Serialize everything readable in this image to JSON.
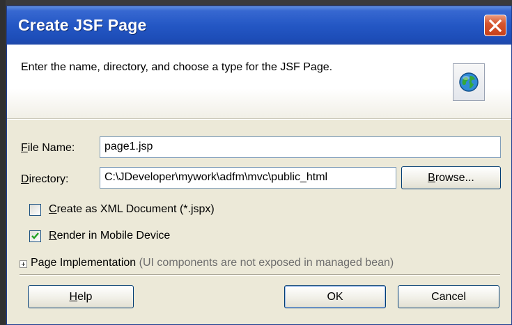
{
  "dialog": {
    "title": "Create JSF Page",
    "description": "Enter the name, directory, and choose a type for the JSF Page.",
    "header_icon": "globe-icon"
  },
  "form": {
    "file_name": {
      "label_underlined": "F",
      "label_rest": "ile Name:",
      "value": "page1.jsp"
    },
    "directory": {
      "label_underlined": "D",
      "label_rest": "irectory:",
      "value": "C:\\JDeveloper\\mywork\\adfm\\mvc\\public_html"
    },
    "browse_button": {
      "label_underlined": "B",
      "label_rest": "rowse..."
    },
    "xml_checkbox": {
      "label_underlined": "C",
      "label_rest": "reate as XML Document (*.jspx)",
      "checked": false
    },
    "mobile_checkbox": {
      "label_underlined": "R",
      "label_rest": "ender in Mobile Device",
      "checked": true
    },
    "page_impl": {
      "label": "Page Implementation",
      "hint": "(UI components are not exposed in managed bean)"
    }
  },
  "buttons": {
    "help": {
      "label_underlined": "H",
      "label_rest": "elp"
    },
    "ok": "OK",
    "cancel": "Cancel"
  }
}
